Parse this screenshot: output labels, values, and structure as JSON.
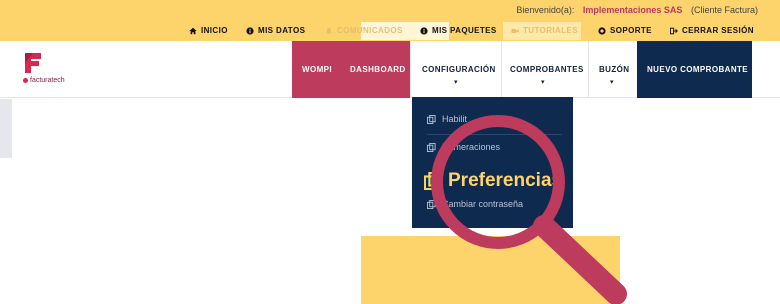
{
  "topbar": {
    "welcome_prefix": "Bienvenido(a):",
    "company": "Implementaciones SAS",
    "role": "(Cliente Factura)",
    "links": [
      {
        "label": "INICIO",
        "icon": "home-icon",
        "dim": false
      },
      {
        "label": "MIS DATOS",
        "icon": "info-icon",
        "dim": false
      },
      {
        "label": "COMUNICADOS",
        "icon": "bell-icon",
        "dim": true
      },
      {
        "label": "MIS PAQUETES",
        "icon": "info-icon",
        "dim": false
      },
      {
        "label": "TUTORIALES",
        "icon": "video-icon",
        "dim": true
      },
      {
        "label": "SOPORTE",
        "icon": "lifebuoy-icon",
        "dim": false
      },
      {
        "label": "CERRAR SESIÓN",
        "icon": "logout-icon",
        "dim": false
      }
    ]
  },
  "logo": {
    "text": "facturatech"
  },
  "mainnav": {
    "wompi": "WOMPI",
    "dashboard": "DASHBOARD",
    "configuracion": "CONFIGURACIÓN",
    "comprobantes": "COMPROBANTES",
    "buzon": "BUZÓN",
    "nuevo": "NUEVO COMPROBANTE"
  },
  "dropdown": {
    "items": [
      {
        "label": "Habilit",
        "icon": "copy-icon"
      },
      {
        "label": "Numeraciones",
        "icon": "copy-icon"
      },
      {
        "label": "Cambiar contraseña",
        "icon": "copy-icon"
      }
    ],
    "highlight": {
      "label": "Preferencias",
      "icon": "copy-icon"
    }
  },
  "colors": {
    "yellow": "#fdd46c",
    "crimson": "#bd3b5d",
    "navy": "#0f2a4f"
  }
}
